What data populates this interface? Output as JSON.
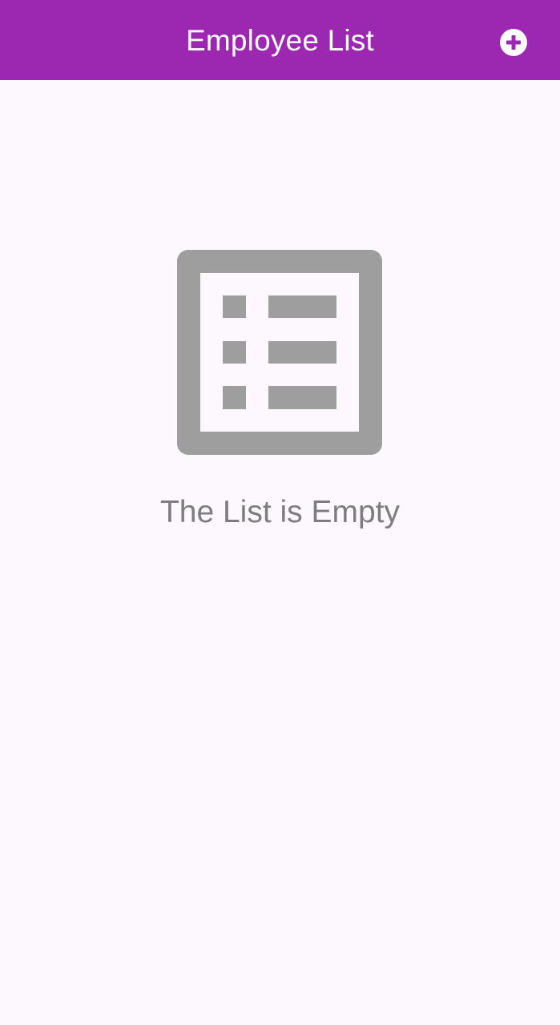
{
  "app_bar": {
    "title": "Employee List",
    "add_icon": "add-circle-icon",
    "background_color": "#9c27b0"
  },
  "empty_state": {
    "icon": "list-alt-icon",
    "message": "The List is Empty",
    "icon_color": "#9e9e9e",
    "text_color": "#7d7d7d"
  },
  "page": {
    "background_color": "#fdf7fe"
  }
}
